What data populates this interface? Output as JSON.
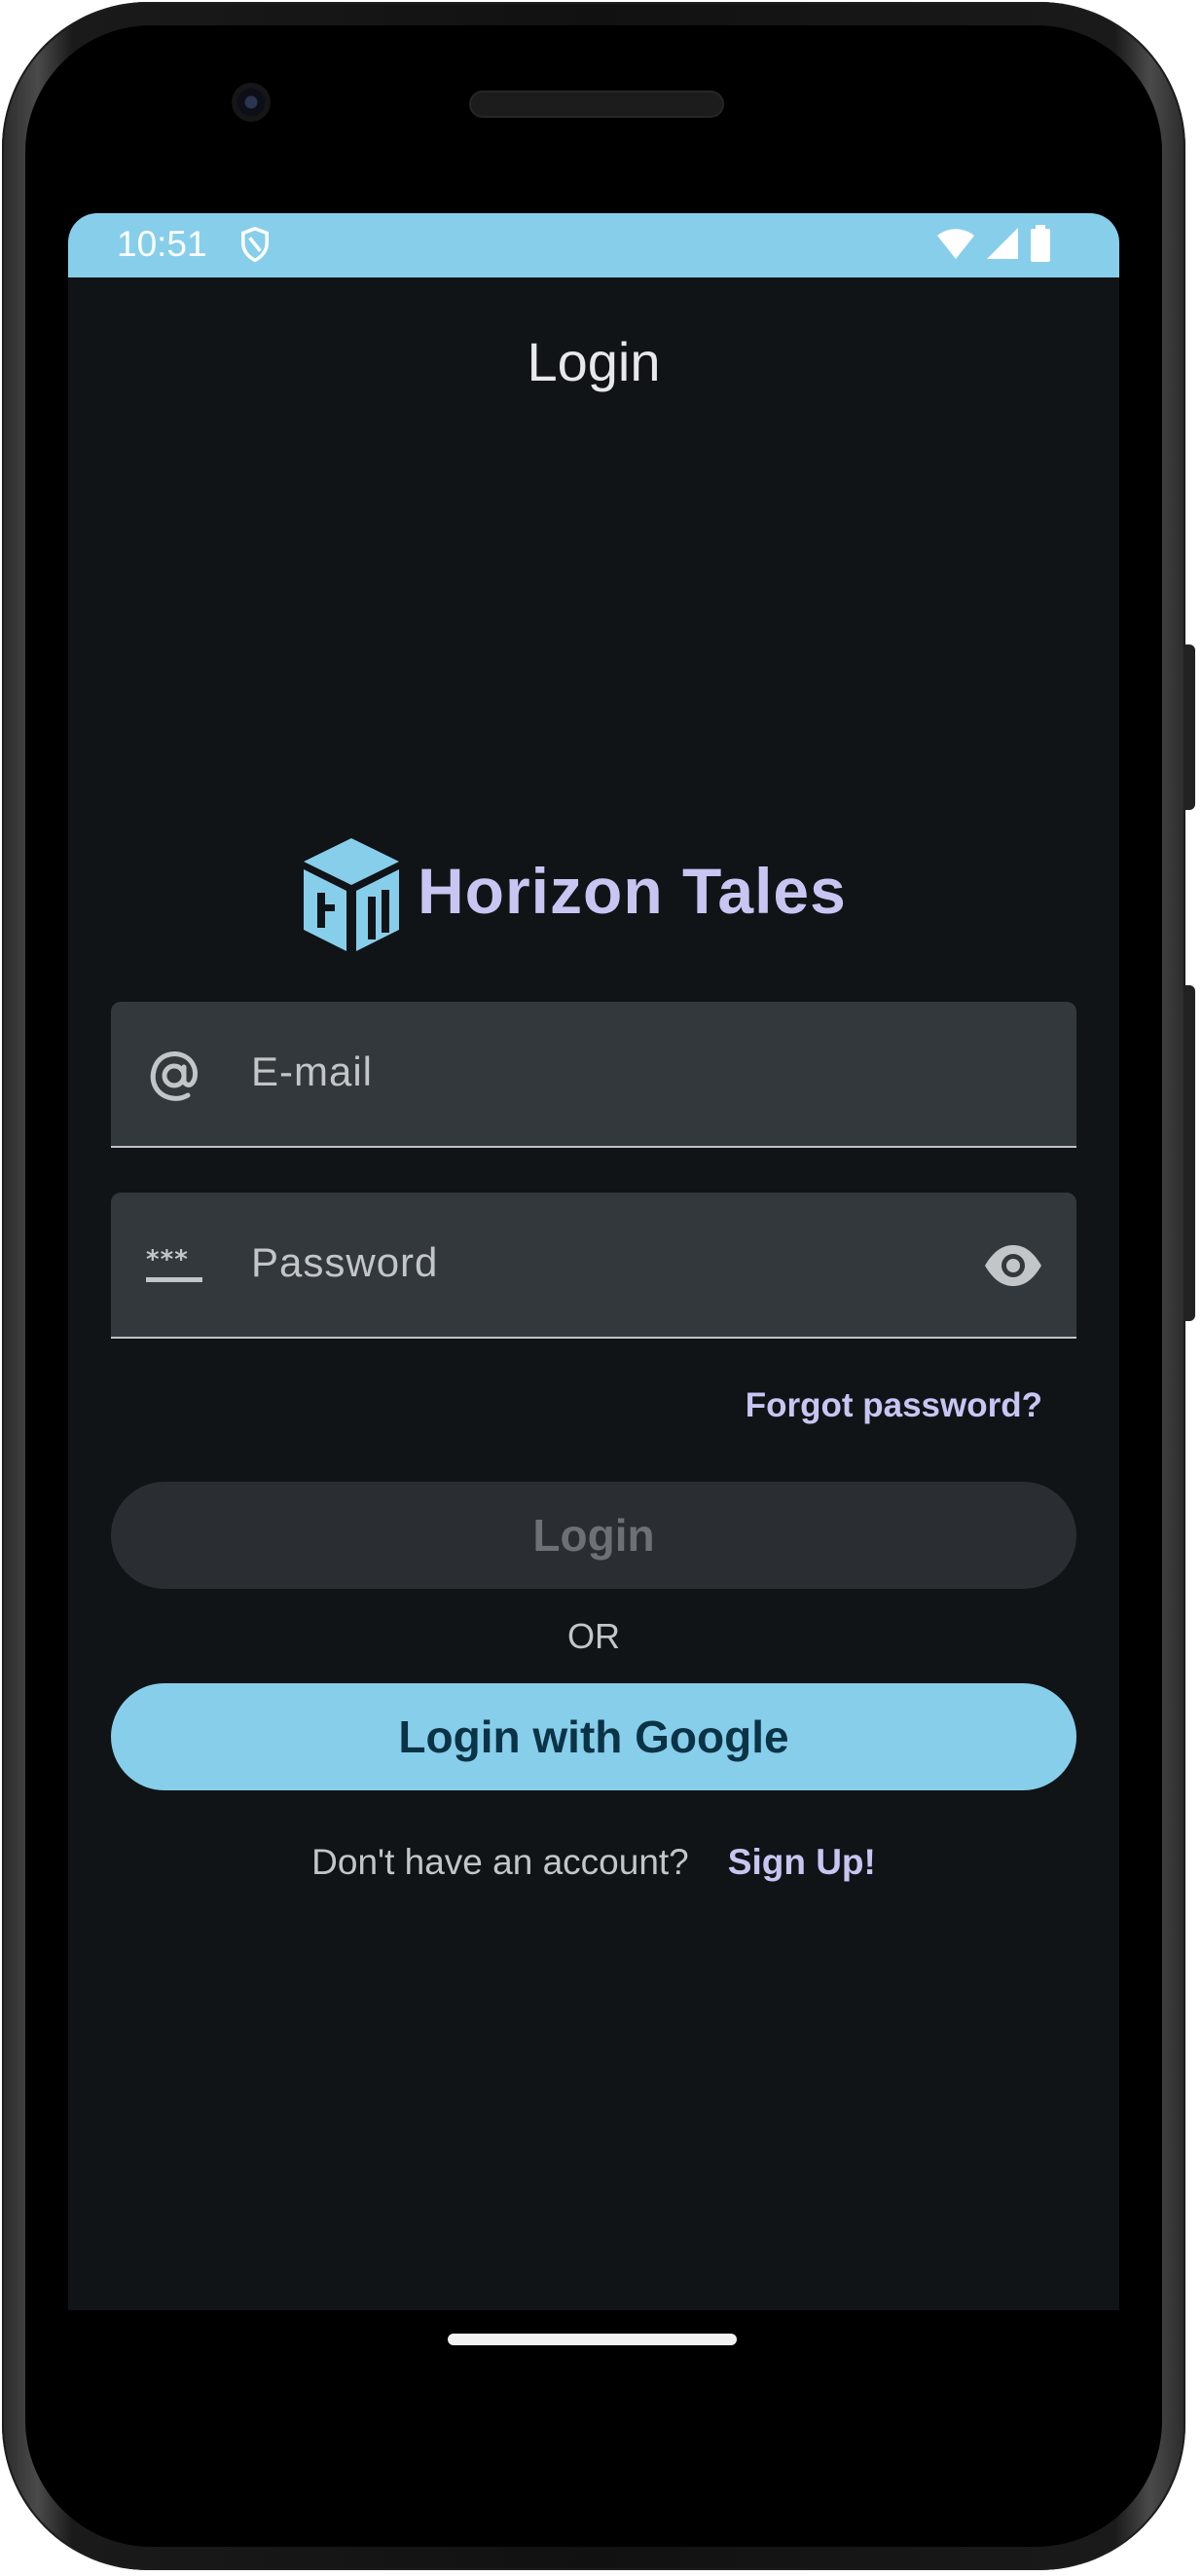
{
  "status_bar": {
    "time": "10:51",
    "background_color": "#87ceeb",
    "icons": [
      "shield-icon",
      "wifi-icon",
      "signal-icon",
      "battery-icon"
    ]
  },
  "header": {
    "title": "Login"
  },
  "logo": {
    "name": "Horizon Tales",
    "mark_color": "#87ceeb",
    "text_color": "#c9c5f2"
  },
  "form": {
    "email": {
      "placeholder": "E-mail",
      "value": "",
      "icon": "at-sign-icon"
    },
    "password": {
      "placeholder": "Password",
      "value": "",
      "icon": "password-icon",
      "toggle_icon": "eye-icon"
    },
    "forgot_label": "Forgot password?"
  },
  "actions": {
    "login_label": "Login",
    "or_label": "OR",
    "google_label": "Login with Google",
    "google_color": "#87ceeb"
  },
  "footer": {
    "signup_prompt": "Don't have an account?",
    "signup_label": "Sign Up!"
  },
  "colors": {
    "background": "#101417",
    "accent": "#87ceeb",
    "link": "#c9c5f2"
  }
}
